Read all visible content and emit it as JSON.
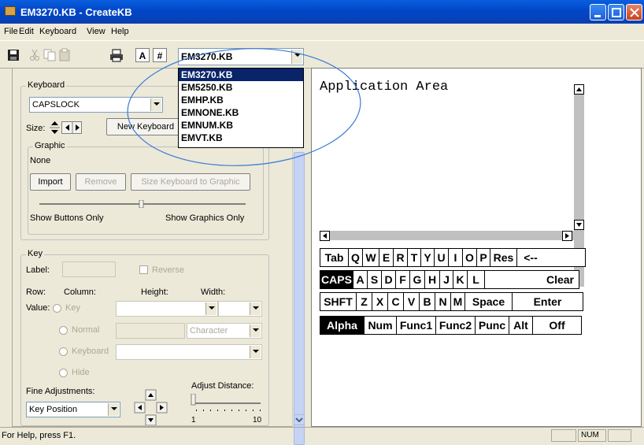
{
  "window": {
    "title": "EM3270.KB - CreateKB"
  },
  "menu": [
    "File",
    "Edit",
    "Keyboard",
    "View",
    "Help"
  ],
  "toolbar": {
    "font_a": "A",
    "font_hash": "#",
    "file_combo_value": "EM3270.KB",
    "file_options": [
      "EM3270.KB",
      "EM5250.KB",
      "EMHP.KB",
      "EMNONE.KB",
      "EMNUM.KB",
      "EMVT.KB"
    ]
  },
  "keyboard_group": {
    "legend": "Keyboard",
    "name_value": "CAPSLOCK",
    "size_label": "Size:",
    "new_keyboard_button": "New Keyboard"
  },
  "graphic_group": {
    "legend": "Graphic",
    "value": "None",
    "import_button": "Import",
    "remove_button": "Remove",
    "size_to_graphic_button": "Size Keyboard to Graphic",
    "show_buttons_only": "Show Buttons Only",
    "show_graphics_only": "Show Graphics Only"
  },
  "key_group": {
    "legend": "Key",
    "label_label": "Label:",
    "reverse_label": "Reverse",
    "row_label": "Row:",
    "column_label": "Column:",
    "height_label": "Height:",
    "width_label": "Width:",
    "value_label": "Value:",
    "radio_key": "Key",
    "radio_normal": "Normal",
    "normal_type": "Character",
    "radio_keyboard": "Keyboard",
    "radio_hide": "Hide",
    "fine_adjustments_label": "Fine Adjustments:",
    "fine_adjustments_value": "Key Position",
    "adjust_distance_label": "Adjust Distance:",
    "slider_min": "1",
    "slider_max": "10"
  },
  "app_area": {
    "title": "Application Area",
    "keyboard_rows": [
      [
        "Tab",
        "Q",
        "W",
        "E",
        "R",
        "T",
        "Y",
        "U",
        "I",
        "O",
        "P",
        "Res",
        "<--"
      ],
      [
        "CAPS",
        "A",
        "S",
        "D",
        "F",
        "G",
        "H",
        "J",
        "K",
        "L",
        "Clear"
      ],
      [
        "SHFT",
        "Z",
        "X",
        "C",
        "V",
        "B",
        "N",
        "M",
        "Space",
        "Enter"
      ],
      [
        "Alpha",
        "Num",
        "Func1",
        "Func2",
        "Punc",
        "Alt",
        "Off"
      ]
    ]
  },
  "statusbar": {
    "help_text": "For Help, press F1.",
    "num": "NUM"
  }
}
